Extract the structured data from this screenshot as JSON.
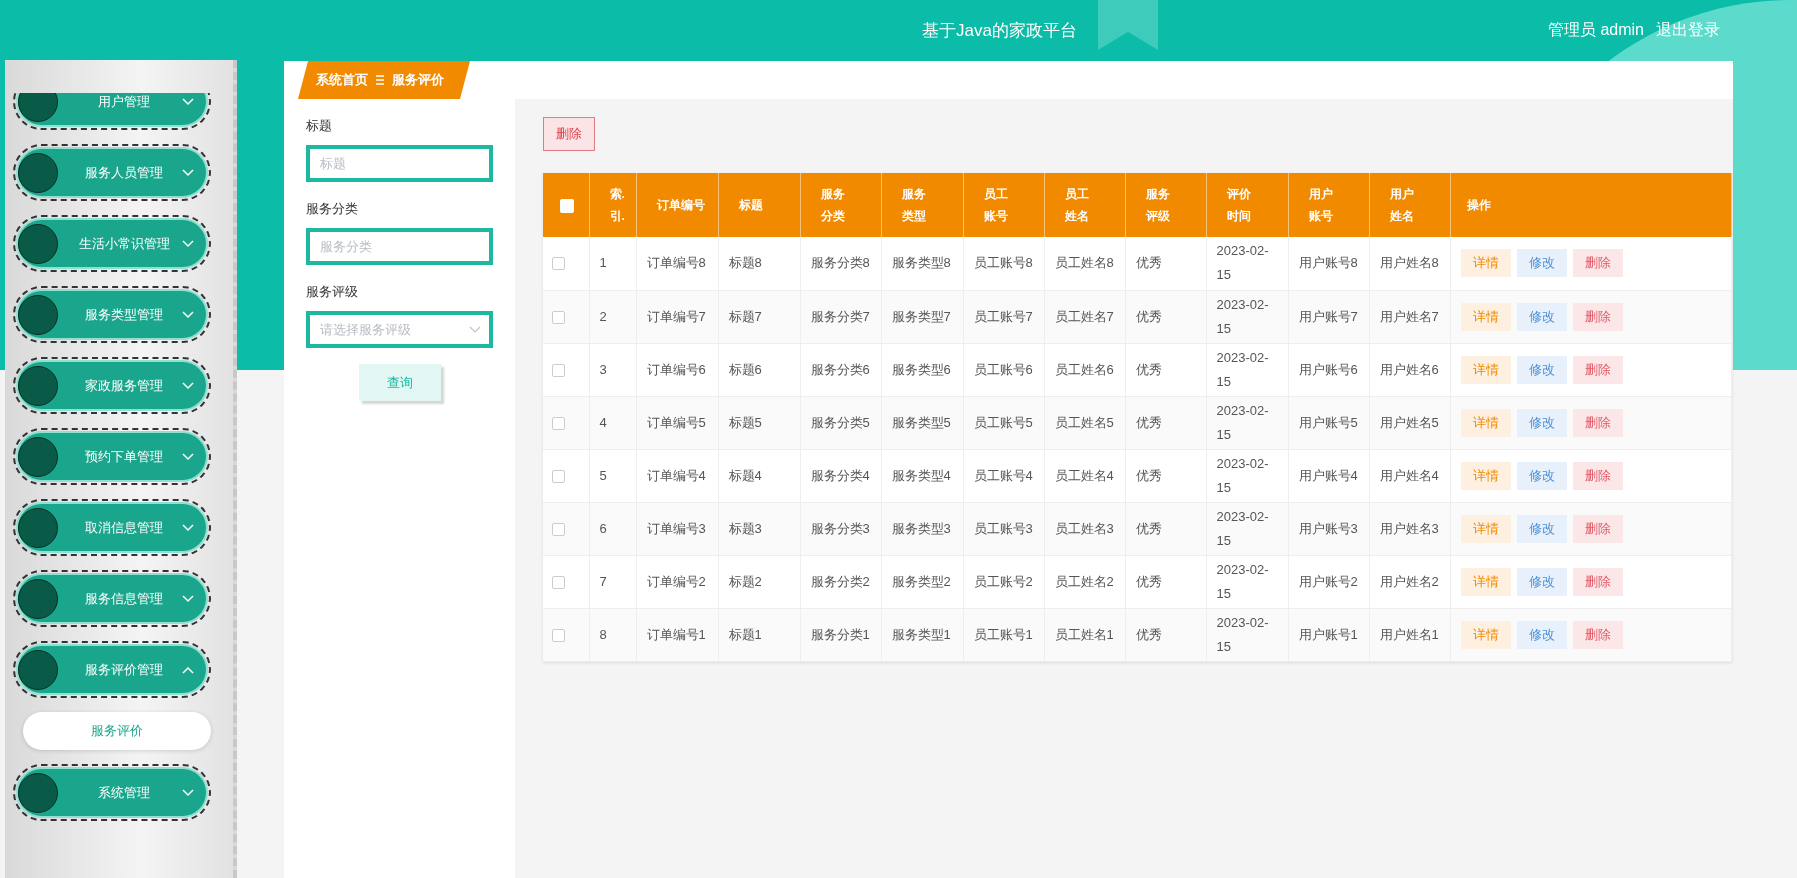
{
  "header": {
    "title": "基于Java的家政平台",
    "user_label": "管理员 admin",
    "logout": "退出登录"
  },
  "sidebar": {
    "items": [
      {
        "label": "用户管理",
        "expanded": false
      },
      {
        "label": "服务人员管理",
        "expanded": false
      },
      {
        "label": "生活小常识管理",
        "expanded": false
      },
      {
        "label": "服务类型管理",
        "expanded": false
      },
      {
        "label": "家政服务管理",
        "expanded": false
      },
      {
        "label": "预约下单管理",
        "expanded": false
      },
      {
        "label": "取消信息管理",
        "expanded": false
      },
      {
        "label": "服务信息管理",
        "expanded": false
      },
      {
        "label": "服务评价管理",
        "expanded": true,
        "children": [
          {
            "label": "服务评价",
            "selected": true
          }
        ]
      },
      {
        "label": "系统管理",
        "expanded": false
      }
    ]
  },
  "breadcrumb": [
    "系统首页",
    "服务评价"
  ],
  "search": {
    "fields": [
      {
        "kind": "input",
        "label": "标题",
        "placeholder": "标题"
      },
      {
        "kind": "input",
        "label": "服务分类",
        "placeholder": "服务分类"
      },
      {
        "kind": "select",
        "label": "服务评级",
        "placeholder": "请选择服务评级"
      }
    ],
    "button": "查询"
  },
  "toolbar": {
    "delete_button": "删除"
  },
  "table": {
    "select_all_checked": false,
    "columns": [
      "索.引.",
      "订单编号",
      "标题",
      "服务分类",
      "服务类型",
      "员工账号",
      "员工姓名",
      "服务评级",
      "评价时间",
      "用户账号",
      "用户姓名",
      "操作"
    ],
    "rows": [
      {
        "checked": false,
        "cells": [
          "1",
          "订单编号8",
          "标题8",
          "服务分类8",
          "服务类型8",
          "员工账号8",
          "员工姓名8",
          "优秀",
          "2023-02-15",
          "用户账号8",
          "用户姓名8"
        ],
        "actions": [
          {
            "kind": "detail",
            "label": "详情"
          },
          {
            "kind": "edit",
            "label": "修改"
          },
          {
            "kind": "delete",
            "label": "删除"
          }
        ]
      },
      {
        "checked": false,
        "cells": [
          "2",
          "订单编号7",
          "标题7",
          "服务分类7",
          "服务类型7",
          "员工账号7",
          "员工姓名7",
          "优秀",
          "2023-02-15",
          "用户账号7",
          "用户姓名7"
        ],
        "actions": [
          {
            "kind": "detail",
            "label": "详情"
          },
          {
            "kind": "edit",
            "label": "修改"
          },
          {
            "kind": "delete",
            "label": "删除"
          }
        ]
      },
      {
        "checked": false,
        "cells": [
          "3",
          "订单编号6",
          "标题6",
          "服务分类6",
          "服务类型6",
          "员工账号6",
          "员工姓名6",
          "优秀",
          "2023-02-15",
          "用户账号6",
          "用户姓名6"
        ],
        "actions": [
          {
            "kind": "detail",
            "label": "详情"
          },
          {
            "kind": "edit",
            "label": "修改"
          },
          {
            "kind": "delete",
            "label": "删除"
          }
        ]
      },
      {
        "checked": false,
        "cells": [
          "4",
          "订单编号5",
          "标题5",
          "服务分类5",
          "服务类型5",
          "员工账号5",
          "员工姓名5",
          "优秀",
          "2023-02-15",
          "用户账号5",
          "用户姓名5"
        ],
        "actions": [
          {
            "kind": "detail",
            "label": "详情"
          },
          {
            "kind": "edit",
            "label": "修改"
          },
          {
            "kind": "delete",
            "label": "删除"
          }
        ]
      },
      {
        "checked": false,
        "cells": [
          "5",
          "订单编号4",
          "标题4",
          "服务分类4",
          "服务类型4",
          "员工账号4",
          "员工姓名4",
          "优秀",
          "2023-02-15",
          "用户账号4",
          "用户姓名4"
        ],
        "actions": [
          {
            "kind": "detail",
            "label": "详情"
          },
          {
            "kind": "edit",
            "label": "修改"
          },
          {
            "kind": "delete",
            "label": "删除"
          }
        ]
      },
      {
        "checked": false,
        "cells": [
          "6",
          "订单编号3",
          "标题3",
          "服务分类3",
          "服务类型3",
          "员工账号3",
          "员工姓名3",
          "优秀",
          "2023-02-15",
          "用户账号3",
          "用户姓名3"
        ],
        "actions": [
          {
            "kind": "detail",
            "label": "详情"
          },
          {
            "kind": "edit",
            "label": "修改"
          },
          {
            "kind": "delete",
            "label": "删除"
          }
        ]
      },
      {
        "checked": false,
        "cells": [
          "7",
          "订单编号2",
          "标题2",
          "服务分类2",
          "服务类型2",
          "员工账号2",
          "员工姓名2",
          "优秀",
          "2023-02-15",
          "用户账号2",
          "用户姓名2"
        ],
        "actions": [
          {
            "kind": "detail",
            "label": "详情"
          },
          {
            "kind": "edit",
            "label": "修改"
          },
          {
            "kind": "delete",
            "label": "删除"
          }
        ]
      },
      {
        "checked": false,
        "cells": [
          "8",
          "订单编号1",
          "标题1",
          "服务分类1",
          "服务类型1",
          "员工账号1",
          "员工姓名1",
          "优秀",
          "2023-02-15",
          "用户账号1",
          "用户姓名1"
        ],
        "actions": [
          {
            "kind": "detail",
            "label": "详情"
          },
          {
            "kind": "edit",
            "label": "修改"
          },
          {
            "kind": "delete",
            "label": "删除"
          }
        ]
      }
    ]
  }
}
